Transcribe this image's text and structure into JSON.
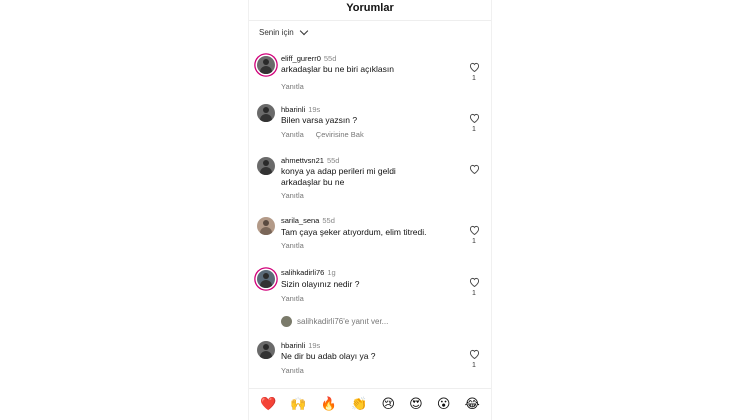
{
  "header": {
    "title": "Yorumlar"
  },
  "filter": {
    "label": "Senin için"
  },
  "comments": [
    {
      "user": "eliff_gurerr0",
      "time": "55d",
      "text": "arkadaşlar bu ne biri açıklasın",
      "reply": "Yanıtla",
      "translate": "",
      "likes": "1"
    },
    {
      "user": "hbarinli",
      "time": "19s",
      "text": "Bilen varsa yazsın ?",
      "reply": "Yanıtla",
      "translate": "Çevirisine Bak",
      "likes": "1"
    },
    {
      "user": "ahmettvsn21",
      "time": "55d",
      "text": "konya ya adap perileri mi geldi arkadaşlar bu ne",
      "reply": "Yanıtla",
      "translate": "",
      "likes": ""
    },
    {
      "user": "sarila_sena",
      "time": "55d",
      "text": "Tam çaya şeker atıyordum, elim titredi.",
      "reply": "Yanıtla",
      "translate": "",
      "likes": "1"
    },
    {
      "user": "salihkadirli76",
      "time": "1g",
      "text": "Sizin olayınız nedir ?",
      "reply": "Yanıtla",
      "translate": "",
      "likes": "1"
    },
    {
      "user": "hbarinli",
      "time": "19s",
      "text": "Ne dir bu adab olayı ya ?",
      "reply": "Yanıtla",
      "translate": "",
      "likes": "1"
    }
  ],
  "reply_link": {
    "text": "salihkadirli76'e yanıt ver..."
  },
  "emojis": [
    "❤️",
    "🙌",
    "🔥",
    "👏",
    "😢",
    "😍",
    "😮",
    "😂"
  ],
  "colors": {
    "ring": "#d1007a",
    "muted": "#777777"
  }
}
